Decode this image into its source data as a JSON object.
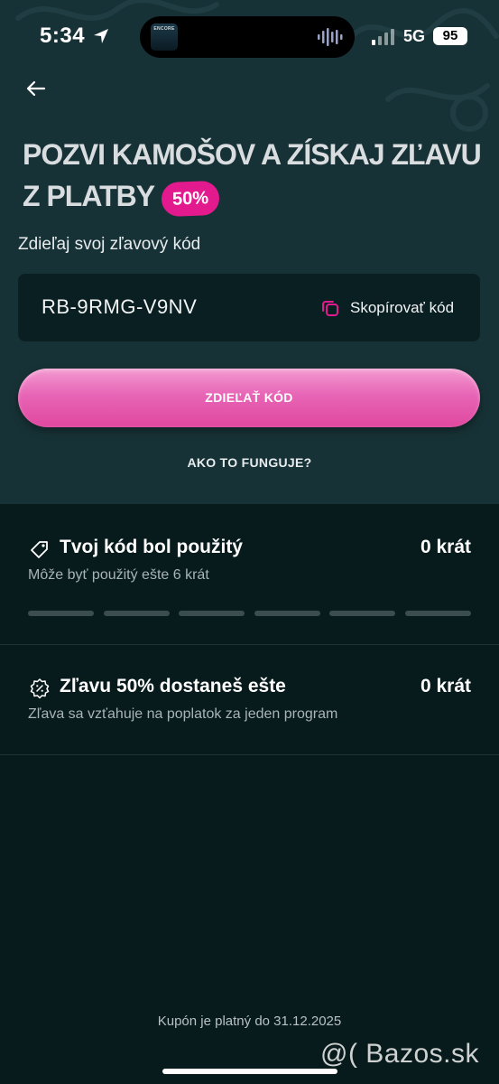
{
  "status_bar": {
    "time": "5:34",
    "network": "5G",
    "battery": "95",
    "album_art_text": "ENCORE"
  },
  "header": {
    "title_line1": "POZVI KAMOŠOV A ZÍSKAJ ZĽAVU",
    "title_line2": "Z PLATBY",
    "discount_badge": "50%"
  },
  "share": {
    "label": "Zdieľaj svoj zľavový kód",
    "code": "RB-9RMG-V9NV",
    "copy_label": "Skopírovať kód",
    "share_button": "ZDIEĽAŤ KÓD",
    "how_it_works": "AKO TO FUNGUJE?"
  },
  "usage": {
    "title": "Tvoj kód bol použitý",
    "count": "0 krát",
    "subtitle": "Môže byť použitý ešte 6 krát",
    "used": 0,
    "total": 6
  },
  "discount": {
    "title": "Zľavu 50% dostaneš ešte",
    "count": "0 krát",
    "subtitle": "Zľava sa vzťahuje na poplatok za jeden program"
  },
  "footer": {
    "validity": "Kupón je platný do 31.12.2025"
  },
  "watermark": "@( Bazos.sk",
  "colors": {
    "accent": "#e31a8e",
    "hero_bg": "#173236",
    "page_bg": "#071a1c",
    "card_bg": "#0a1f22"
  }
}
